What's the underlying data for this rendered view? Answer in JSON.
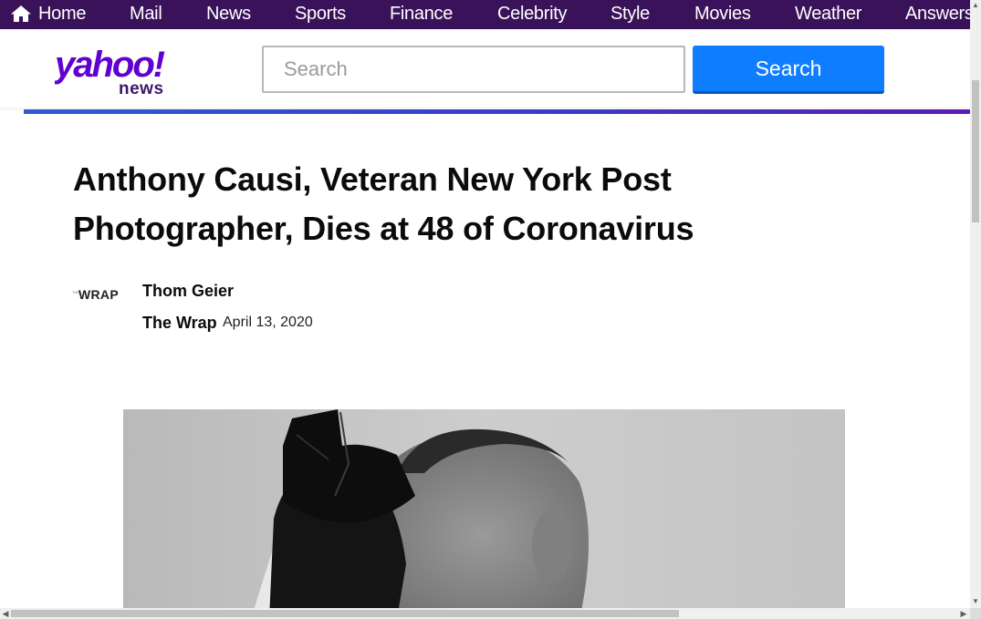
{
  "topnav": {
    "items": [
      {
        "label": "Home"
      },
      {
        "label": "Mail"
      },
      {
        "label": "News"
      },
      {
        "label": "Sports"
      },
      {
        "label": "Finance"
      },
      {
        "label": "Celebrity"
      },
      {
        "label": "Style"
      },
      {
        "label": "Movies"
      },
      {
        "label": "Weather"
      },
      {
        "label": "Answers"
      }
    ]
  },
  "header": {
    "logo_text": "yahoo!",
    "logo_sub": "news",
    "search_placeholder": "Search",
    "search_button": "Search"
  },
  "article": {
    "title": "Anthony Causi, Veteran New York Post Photographer, Dies at 48 of Coronavirus",
    "provider_logo_text": "WRAP",
    "provider_logo_small": "THE",
    "author": "Thom Geier",
    "source": "The Wrap",
    "date": "April 13, 2020"
  },
  "colors": {
    "nav_bg": "#3a1259",
    "brand_purple": "#6001d2",
    "search_blue": "#0f7dff"
  },
  "icons": {
    "home": "home-icon",
    "scroll_up": "chevron-up-icon",
    "scroll_down": "chevron-down-icon",
    "scroll_left": "chevron-left-icon",
    "scroll_right": "chevron-right-icon"
  }
}
